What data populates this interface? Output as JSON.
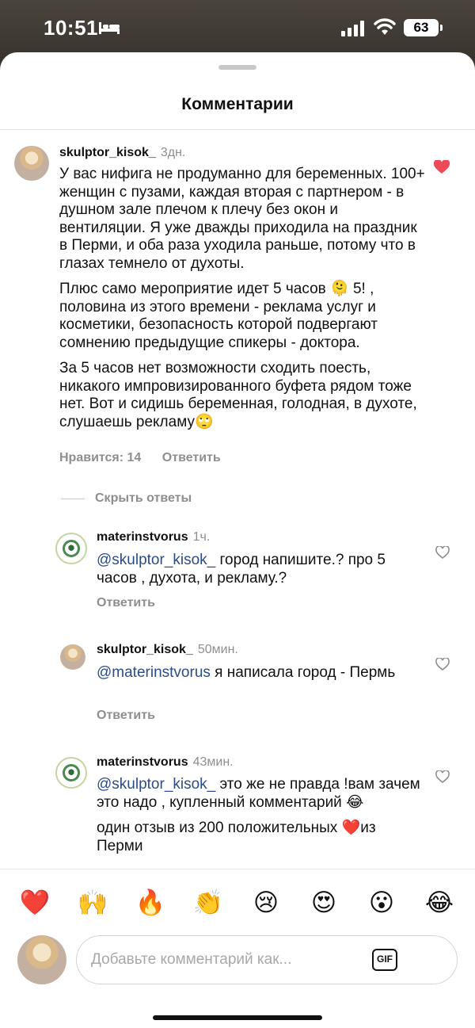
{
  "status_bar": {
    "time": "10:51",
    "battery": "63"
  },
  "sheet": {
    "title": "Комментарии"
  },
  "comment": {
    "username": "skulptor_kisok_",
    "time": "3дн.",
    "paragraphs": [
      "У вас нифига не продуманно для беременных. 100+ женщин с пузами, каждая вторая с партнером - в душном зале плечом к плечу без окон и вентиляции. Я уже дважды приходила на праздник в Перми, и оба раза уходила раньше, потому что в глазах темнело от духоты.",
      "Плюс само мероприятие идет 5 часов 🫠 5! , половина из этого времени - реклама услуг и косметики, безопасность которой подвергают сомнению предыдущие спикеры - доктора.",
      "За 5 часов нет возможности сходить поесть, никакого импровизированного буфета рядом тоже нет. Вот и сидишь беременная, голодная, в духоте, слушаешь рекламу🙄"
    ],
    "likes_label": "Нравится: 14",
    "reply_label": "Ответить"
  },
  "hide_replies_label": "Скрыть ответы",
  "replies": [
    {
      "username": "materinstvorus",
      "time": "1ч.",
      "mention": "@skulptor_kisok_",
      "text": " город напишите.? про 5 часов , духота, и рекламу.?",
      "reply_label": "Ответить"
    },
    {
      "username": "skulptor_kisok_",
      "time": "50мин.",
      "mention": "@materinstvorus",
      "text": " я написала город - Пермь",
      "reply_label": "Ответить"
    },
    {
      "username": "materinstvorus",
      "time": "43мин.",
      "mention": "@skulptor_kisok_",
      "text": " это же не правда !вам зачем это надо , купленный комментарий 😂",
      "text2": "один отзыв из 200 положительных ❤️из Перми"
    }
  ],
  "reactions": [
    "❤️",
    "🙌",
    "🔥",
    "👏",
    "😢",
    "😍",
    "😮",
    "😂"
  ],
  "composer": {
    "placeholder": "Добавьте комментарий как...",
    "gif_label": "GIF"
  },
  "colors": {
    "like_red": "#ed4956",
    "mention_blue": "#2b4c86",
    "meta_gray": "#8e8e8e"
  }
}
